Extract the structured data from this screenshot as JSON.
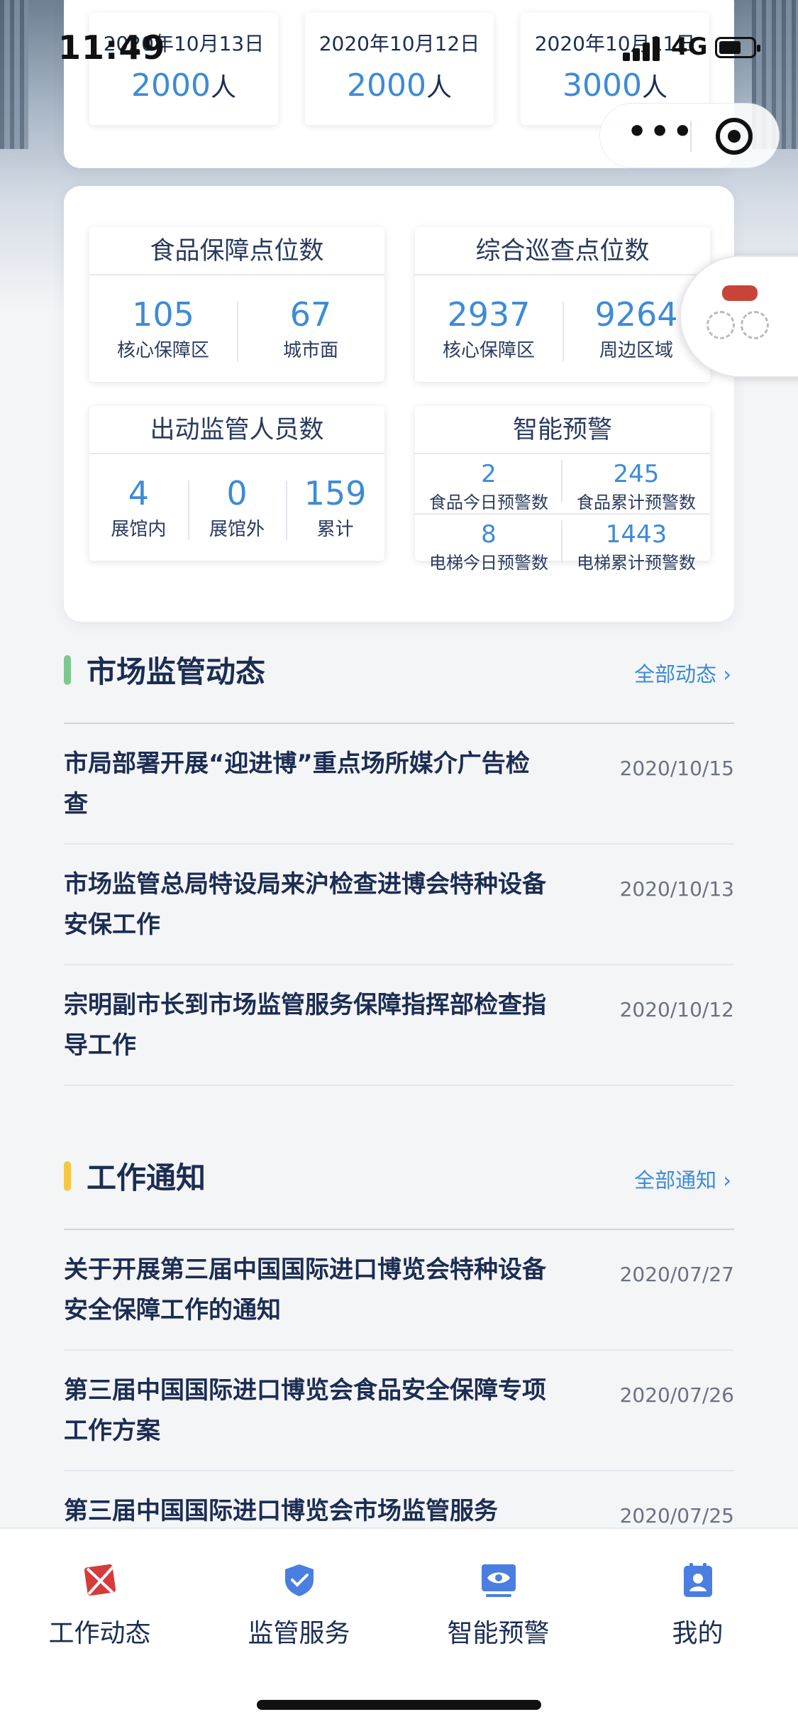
{
  "status_bar": {
    "time": "11:49",
    "network": "4G"
  },
  "visitors": [
    {
      "date": "2020年10月13日",
      "count": "2000",
      "unit": "人"
    },
    {
      "date": "2020年10月12日",
      "count": "2000",
      "unit": "人"
    },
    {
      "date": "2020年10月11日",
      "count": "3000",
      "unit": "人"
    }
  ],
  "stats": {
    "food": {
      "title": "食品保障点位数",
      "cells": [
        {
          "value": "105",
          "label": "核心保障区"
        },
        {
          "value": "67",
          "label": "城市面"
        }
      ]
    },
    "patrol": {
      "title": "综合巡查点位数",
      "cells": [
        {
          "value": "2937",
          "label": "核心保障区"
        },
        {
          "value": "9264",
          "label": "周边区域"
        }
      ]
    },
    "staff": {
      "title": "出动监管人员数",
      "cells": [
        {
          "value": "4",
          "label": "展馆内"
        },
        {
          "value": "0",
          "label": "展馆外"
        },
        {
          "value": "159",
          "label": "累计"
        }
      ]
    },
    "warning": {
      "title": "智能预警",
      "cells": [
        {
          "value": "2",
          "label": "食品今日预警数"
        },
        {
          "value": "245",
          "label": "食品累计预警数"
        },
        {
          "value": "8",
          "label": "电梯今日预警数"
        },
        {
          "value": "1443",
          "label": "电梯累计预警数"
        }
      ]
    }
  },
  "market_news": {
    "title": "市场监管动态",
    "more": "全部动态 ›",
    "bar_color": "#7cc98e",
    "items": [
      {
        "title": "市局部署开展“迎进博”重点场所媒介广告检查",
        "date": "2020/10/15"
      },
      {
        "title": "市场监管总局特设局来沪检查进博会特种设备安保工作",
        "date": "2020/10/13"
      },
      {
        "title": "宗明副市长到市场监管服务保障指挥部检查指导工作",
        "date": "2020/10/12"
      }
    ]
  },
  "work_notices": {
    "title": "工作通知",
    "more": "全部通知 ›",
    "bar_color": "#f5c842",
    "items": [
      {
        "title": "关于开展第三届中国国际进口博览会特种设备安全保障工作的通知",
        "date": "2020/07/27"
      },
      {
        "title": "第三届中国国际进口博览会食品安全保障专项工作方案",
        "date": "2020/07/26"
      },
      {
        "title": "第三届中国国际进口博览会市场监管服务",
        "date": "2020/07/25"
      }
    ]
  },
  "tabs": [
    {
      "label": "工作动态",
      "icon": "work-dynamics-icon",
      "color": "#d63a3a"
    },
    {
      "label": "监管服务",
      "icon": "shield-check-icon",
      "color": "#4a7ee0"
    },
    {
      "label": "智能预警",
      "icon": "eye-monitor-icon",
      "color": "#4a7ee0"
    },
    {
      "label": "我的",
      "icon": "profile-card-icon",
      "color": "#4a7ee0"
    }
  ]
}
